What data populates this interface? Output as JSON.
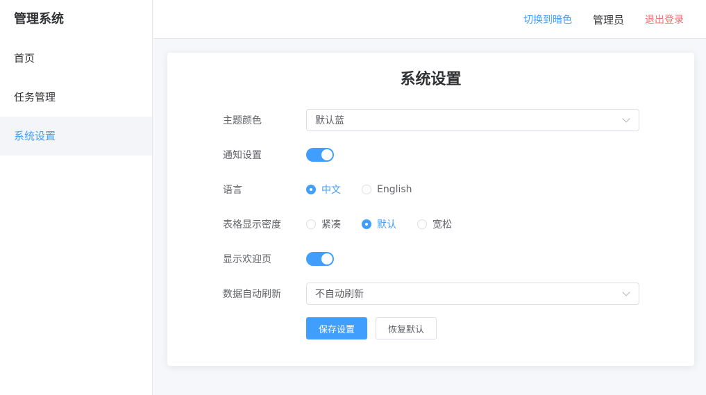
{
  "sidebar": {
    "brand": "管理系统",
    "items": [
      {
        "label": "首页"
      },
      {
        "label": "任务管理"
      },
      {
        "label": "系统设置"
      }
    ]
  },
  "header": {
    "theme_toggle": "切换到暗色",
    "username": "管理员",
    "logout": "退出登录"
  },
  "settings": {
    "title": "系统设置",
    "theme_color": {
      "label": "主题颜色",
      "value": "默认蓝"
    },
    "notifications": {
      "label": "通知设置",
      "enabled": true
    },
    "language": {
      "label": "语言",
      "options": [
        "中文",
        "English"
      ],
      "selected": "中文"
    },
    "density": {
      "label": "表格显示密度",
      "options": [
        "紧凑",
        "默认",
        "宽松"
      ],
      "selected": "默认"
    },
    "welcome_page": {
      "label": "显示欢迎页",
      "enabled": true
    },
    "auto_refresh": {
      "label": "数据自动刷新",
      "value": "不自动刷新"
    },
    "save_label": "保存设置",
    "reset_label": "恢复默认"
  },
  "colors": {
    "accent": "#409eff",
    "danger": "#f56c6c",
    "active_bg": "#f3f5f8"
  }
}
